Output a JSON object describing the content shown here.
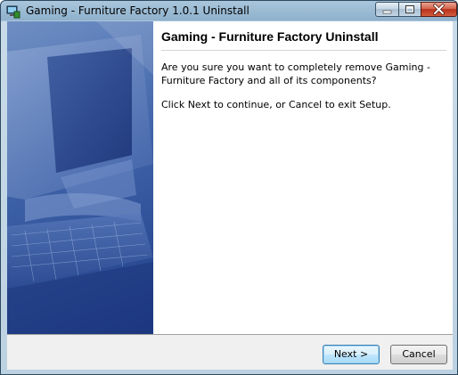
{
  "window": {
    "title": "Gaming - Furniture Factory 1.0.1 Uninstall"
  },
  "page": {
    "heading": "Gaming - Furniture Factory Uninstall",
    "confirm_text": "Are you sure you want to completely remove Gaming - Furniture Factory and all of its components?",
    "instruction_text": "Click Next to continue, or Cancel to exit Setup."
  },
  "buttons": {
    "next_label": "Next >",
    "cancel_label": "Cancel"
  },
  "colors": {
    "side_panel": "#3f63a8",
    "next_focus_border": "#3c7fb1",
    "close_button": "#c8472b"
  }
}
